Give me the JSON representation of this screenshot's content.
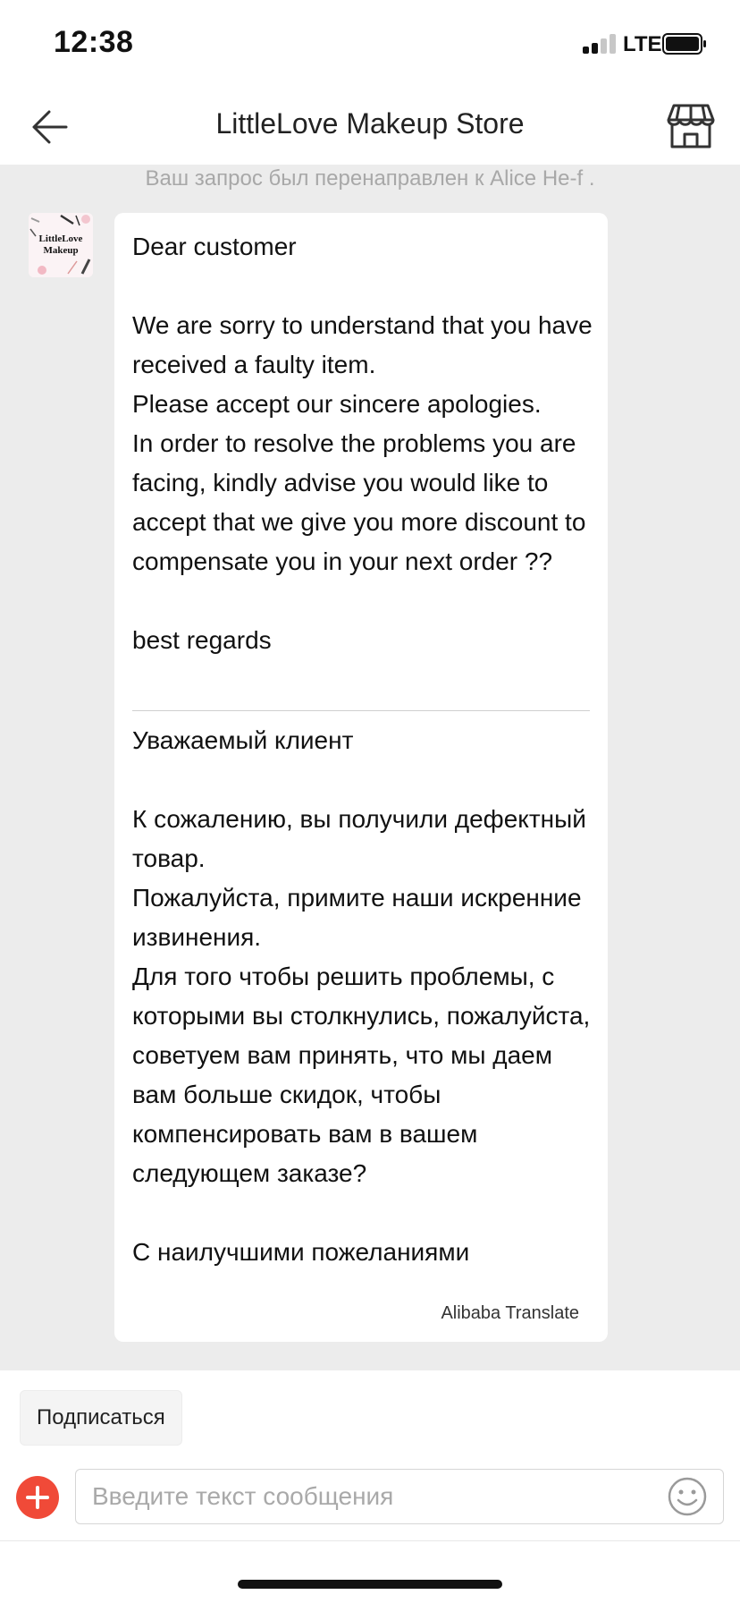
{
  "status_bar": {
    "time": "12:38",
    "network": "LTE"
  },
  "header": {
    "title": "LittleLove Makeup Store",
    "back_icon": "arrow-left-icon",
    "store_icon": "storefront-icon"
  },
  "chat": {
    "redirect_note": "Ваш запрос был перенаправлен к Alice He-f .",
    "avatar_text": "LittleLove\nMakeup",
    "message": {
      "original": "Dear customer\n\nWe are sorry to understand that you have received a faulty item.\nPlease accept our sincere apologies.\nIn order to resolve the problems you are facing, kindly advise you would like to accept that we give you more discount to compensate you in your next order ??\n\nbest regards",
      "translation": "Уважаемый клиент\n\nК сожалению, вы получили дефектный товар.\nПожалуйста, примите наши искренние извинения.\nДля того чтобы решить проблемы, с которыми вы столкнулись, пожалуйста, советуем вам принять, что мы даем вам больше скидок, чтобы компенсировать вам в вашем следующем заказе?\n\nС наилучшими пожеланиями",
      "translation_credit": "Alibaba Translate"
    }
  },
  "composer": {
    "subscribe_label": "Подписаться",
    "input_placeholder": "Введите текст сообщения",
    "input_value": "",
    "add_icon": "plus-icon",
    "emoji_icon": "smiley-icon"
  },
  "colors": {
    "accent": "#f04a38",
    "chat_background": "#ececec"
  }
}
